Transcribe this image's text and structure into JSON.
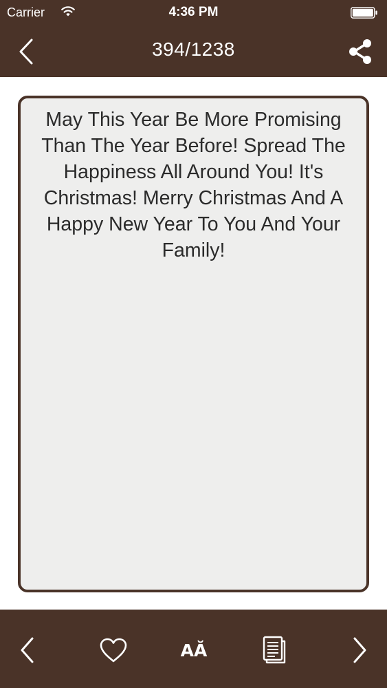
{
  "status_bar": {
    "carrier": "Carrier",
    "time": "4:36 PM"
  },
  "nav": {
    "title": "394/1238",
    "back_icon": "chevron-left-icon",
    "share_icon": "share-icon"
  },
  "message": {
    "text": "May This Year Be More Promising Than The Year Before! Spread The Happiness All Around You! It's Christmas! Merry Christmas And A Happy New Year To You And Your Family!"
  },
  "toolbar": {
    "font_label": "AĂ",
    "icons": [
      "chevron-left-icon",
      "heart-icon",
      "font-size-icon",
      "copy-icon",
      "chevron-right-icon"
    ]
  },
  "colors": {
    "bar_background": "#4a3328",
    "card_background": "#eeeeed",
    "card_border": "#4a3328",
    "text": "#2b2b2b",
    "bar_foreground": "#ffffff"
  }
}
